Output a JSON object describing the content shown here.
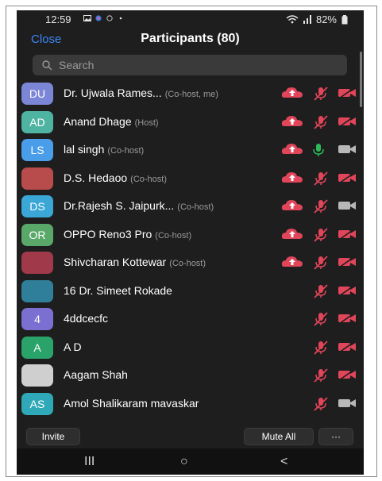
{
  "status_bar": {
    "time": "12:59",
    "battery": "82%"
  },
  "header": {
    "close_label": "Close",
    "title": "Participants (80)"
  },
  "search": {
    "placeholder": "Search"
  },
  "participants": [
    {
      "avatar": "DU",
      "avatar_color": "#7b86d6",
      "name": "Dr. Ujwala Rames...",
      "role": "(Co-host, me)",
      "sharing": true,
      "mic": "muted",
      "video": "off"
    },
    {
      "avatar": "AD",
      "avatar_color": "#4fb3a2",
      "name": "Anand Dhage",
      "role": "(Host)",
      "sharing": true,
      "mic": "muted",
      "video": "off"
    },
    {
      "avatar": "LS",
      "avatar_color": "#4a9de8",
      "name": "lal singh",
      "role": "(Co-host)",
      "sharing": true,
      "mic": "on",
      "video": "on"
    },
    {
      "avatar": "",
      "avatar_color": "#b84b4b",
      "name": "D.S. Hedaoo",
      "role": "(Co-host)",
      "sharing": true,
      "mic": "muted",
      "video": "off"
    },
    {
      "avatar": "DS",
      "avatar_color": "#3aa7d6",
      "name": "Dr.Rajesh S. Jaipurk...",
      "role": "(Co-host)",
      "sharing": true,
      "mic": "muted",
      "video": "on"
    },
    {
      "avatar": "OR",
      "avatar_color": "#59a869",
      "name": "OPPO Reno3 Pro",
      "role": "(Co-host)",
      "sharing": true,
      "mic": "muted",
      "video": "off"
    },
    {
      "avatar": "",
      "avatar_color": "#a0394a",
      "name": "Shivcharan Kottewar",
      "role": "(Co-host)",
      "sharing": true,
      "mic": "muted",
      "video": "off"
    },
    {
      "avatar": "",
      "avatar_color": "#2f7f9a",
      "name": "16 Dr. Simeet Rokade",
      "role": "",
      "sharing": false,
      "mic": "muted",
      "video": "off"
    },
    {
      "avatar": "4",
      "avatar_color": "#7b6fd1",
      "name": "4ddcecfc",
      "role": "",
      "sharing": false,
      "mic": "muted",
      "video": "off"
    },
    {
      "avatar": "A",
      "avatar_color": "#2aa36b",
      "name": "A D",
      "role": "",
      "sharing": false,
      "mic": "muted",
      "video": "off"
    },
    {
      "avatar": "",
      "avatar_color": "#cfcfcf",
      "name": "Aagam Shah",
      "role": "",
      "sharing": false,
      "mic": "muted",
      "video": "off"
    },
    {
      "avatar": "AS",
      "avatar_color": "#2fa9b7",
      "name": "Amol Shalikaram mavaskar",
      "role": "",
      "sharing": false,
      "mic": "muted",
      "video": "on"
    }
  ],
  "footer": {
    "invite_label": "Invite",
    "mute_all_label": "Mute All",
    "more_label": "···"
  },
  "navbar": {
    "recent_label": "III",
    "home_label": "○",
    "back_label": "<"
  },
  "colors": {
    "accent": "#3b86f7",
    "muted_red": "#e0455a",
    "mic_on": "#2dbb5a",
    "cam_gray": "#b8b8b8"
  }
}
